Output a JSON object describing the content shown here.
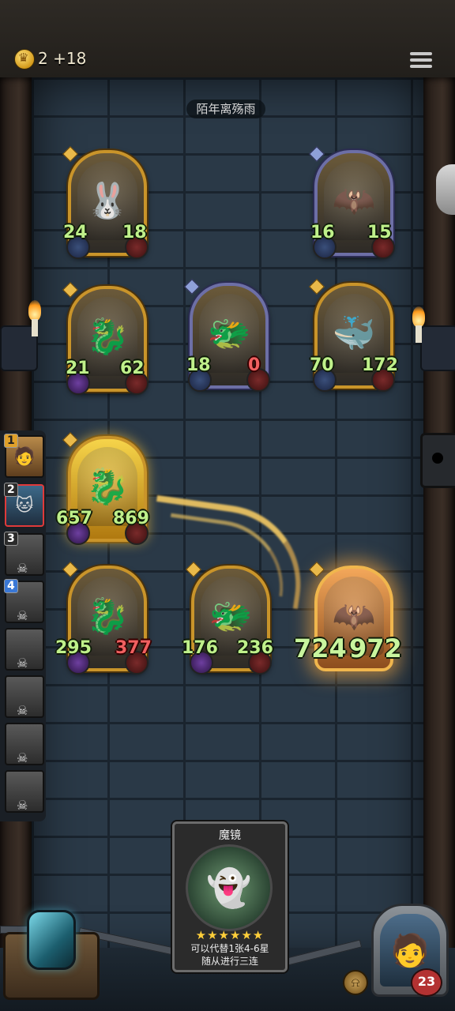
{
  "topbar": {
    "coins": "2 +18"
  },
  "opponent": {
    "name": "陌年离殇雨"
  },
  "opponent_board": [
    {
      "name": "rabbit-masked-minion",
      "attack": "24",
      "health": "18",
      "icon": "rabbit"
    },
    {
      "name": "caged-bat-minion",
      "attack": "16",
      "health": "15",
      "icon": "bat"
    },
    {
      "name": "grey-dragon-minion",
      "attack": "21",
      "health": "62",
      "icon": "dragon"
    },
    {
      "name": "blue-dragon-minion",
      "attack": "18",
      "health": "0",
      "icon": "dragon"
    },
    {
      "name": "blue-sea-dragon-minion",
      "attack": "70",
      "health": "172",
      "icon": "dragon"
    }
  ],
  "player_board": [
    {
      "name": "golden-dragon-minion",
      "attack": "657",
      "health": "869",
      "icon": "dragon"
    },
    {
      "name": "grey-dragon-minion",
      "attack": "295",
      "health": "377",
      "icon": "dragon"
    },
    {
      "name": "red-dragon-minion",
      "attack": "176",
      "health": "236",
      "icon": "dragon"
    },
    {
      "name": "glowing-bat-minion",
      "attack": "724",
      "health": "972",
      "icon": "bat"
    }
  ],
  "roster": [
    {
      "rank": "1",
      "icon": "hero-portrait"
    },
    {
      "rank": "2",
      "icon": "cat-portrait"
    },
    {
      "rank": "3",
      "icon": "skull"
    },
    {
      "rank": "4",
      "icon": "skull"
    },
    {
      "rank": "",
      "icon": "skull"
    },
    {
      "rank": "",
      "icon": "skull"
    },
    {
      "rank": "",
      "icon": "skull"
    },
    {
      "rank": "",
      "icon": "skull"
    }
  ],
  "hand_card": {
    "title": "魔镜",
    "stars": "★★★★★★",
    "description_line1": "可以代替1张4-6星",
    "description_line2": "随从进行三连"
  },
  "hero": {
    "health": "23"
  },
  "colors": {
    "attack_green": "#bff08a",
    "damaged_red": "#f06060",
    "gold_border": "#c9942a",
    "blue_border": "#6d6fa6",
    "wall": "#2a3947"
  }
}
